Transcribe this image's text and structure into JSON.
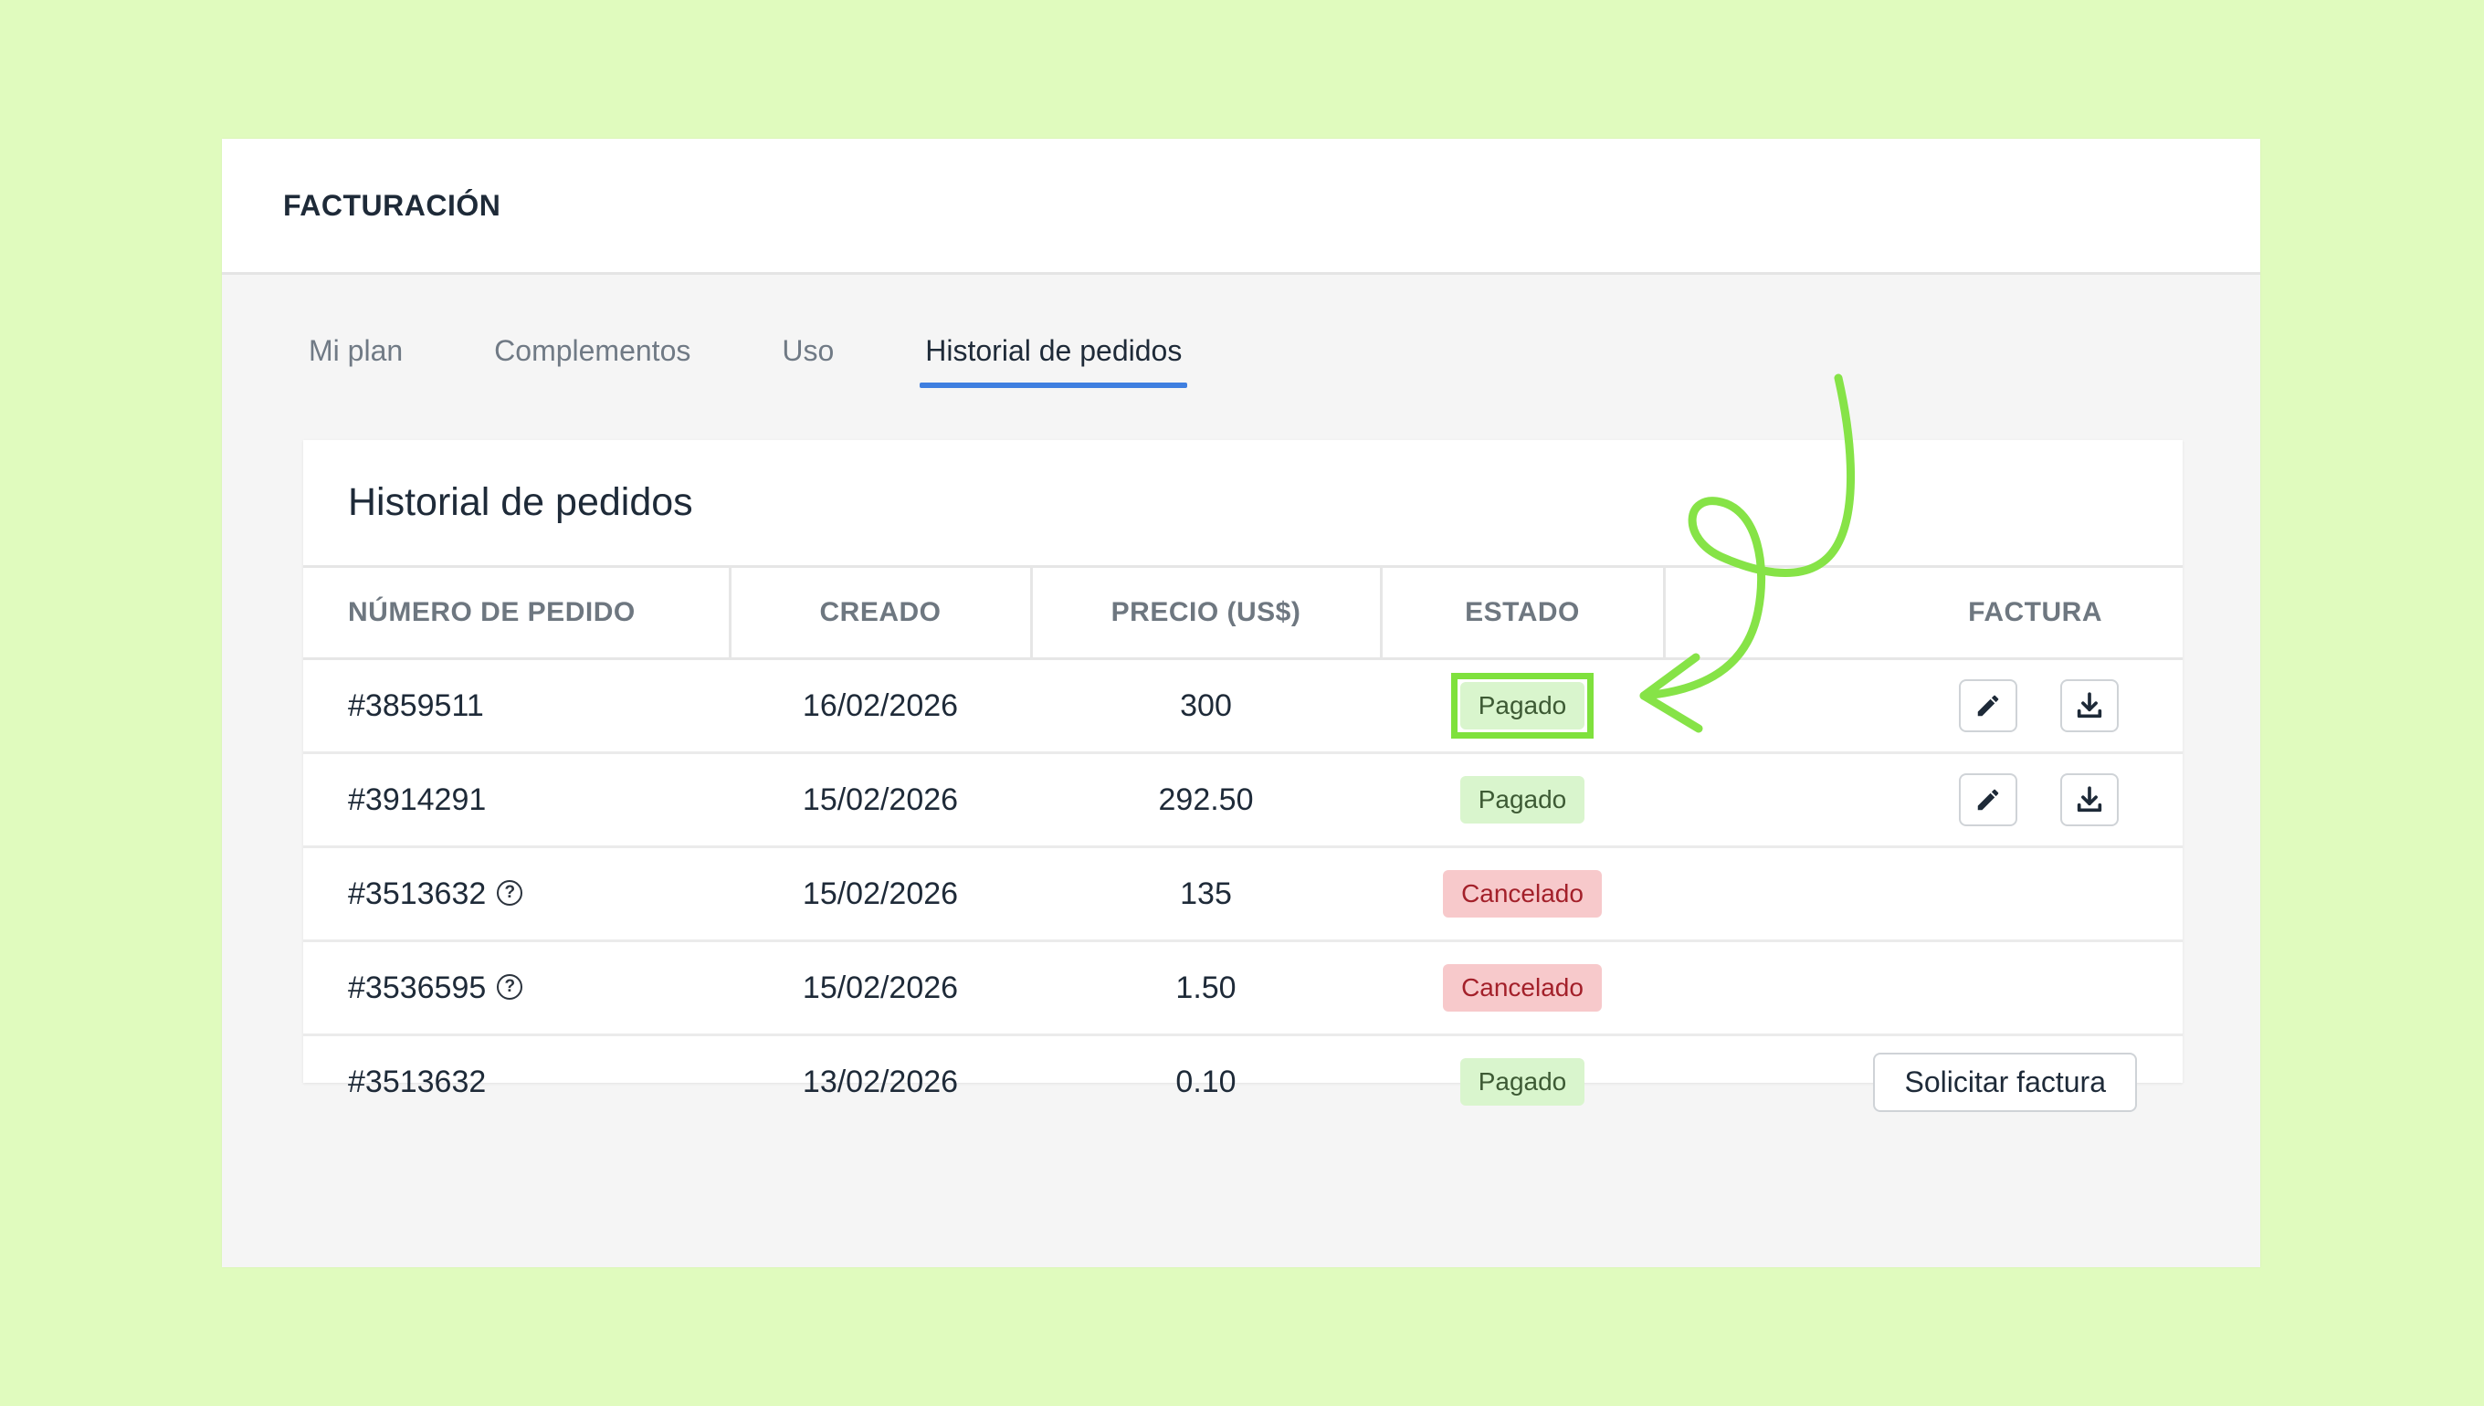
{
  "header": {
    "title": "FACTURACIÓN"
  },
  "tabs": [
    {
      "label": "Mi plan",
      "active": false
    },
    {
      "label": "Complementos",
      "active": false
    },
    {
      "label": "Uso",
      "active": false
    },
    {
      "label": "Historial de pedidos",
      "active": true
    }
  ],
  "card": {
    "title": "Historial de pedidos",
    "columns": [
      "NÚMERO DE PEDIDO",
      "CREADO",
      "PRECIO (US$)",
      "ESTADO",
      "FACTURA"
    ],
    "rows": [
      {
        "order": "#3859511",
        "created": "16/02/2026",
        "price": "300",
        "status": "Pagado"
      },
      {
        "order": "#3914291",
        "created": "15/02/2026",
        "price": "292.50",
        "status": "Pagado"
      },
      {
        "order": "#3513632",
        "created": "15/02/2026",
        "price": "135",
        "status": "Cancelado"
      },
      {
        "order": "#3536595",
        "created": "15/02/2026",
        "price": "1.50",
        "status": "Cancelado"
      },
      {
        "order": "#3513632",
        "created": "13/02/2026",
        "price": "0.10",
        "status": "Pagado"
      }
    ],
    "request_invoice_label": "Solicitar factura",
    "help_glyph": "?"
  },
  "colors": {
    "background": "#e0fbbe",
    "accent": "#3f7fe0",
    "highlight": "#7fe13d",
    "paid_bg": "#d9f5cd",
    "cancelled_bg": "#f7c9cb"
  },
  "icons": [
    "pencil-icon",
    "download-icon",
    "help-circle-icon",
    "hand-drawn-arrow"
  ]
}
